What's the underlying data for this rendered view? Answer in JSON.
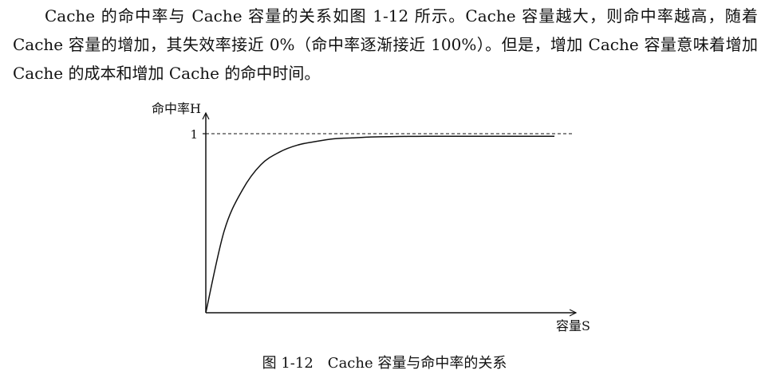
{
  "body_text": "Cache 的命中率与 Cache 容量的关系如图 1-12 所示。Cache 容量越大，则命中率越高，随着 Cache 容量的增加，其失效率接近 0%（命中率逐渐接近 100%）。但是，增加 Cache 容量意味着增加 Cache 的成本和增加 Cache 的命中时间。",
  "figure": {
    "number": "图 1-12",
    "title": "Cache 容量与命中率的关系"
  },
  "chart_data": {
    "type": "line",
    "xlabel": "容量S",
    "ylabel": "命中率H",
    "y_tick_labels": [
      "1"
    ],
    "ylim": [
      0,
      1
    ],
    "xlim": [
      0,
      1
    ],
    "grid": false,
    "reference_line": {
      "y": 1,
      "style": "dashed"
    },
    "series": [
      {
        "x": [
          0,
          0.05,
          0.1,
          0.15,
          0.2,
          0.25,
          0.3,
          0.35,
          0.4,
          0.45,
          0.5,
          0.55,
          0.6,
          0.65,
          0.7,
          0.75,
          0.8,
          0.85,
          0.9,
          0.95
        ],
        "y": [
          0,
          0.47,
          0.7,
          0.84,
          0.91,
          0.95,
          0.97,
          0.985,
          0.99,
          0.995,
          0.997,
          0.998,
          0.999,
          0.999,
          0.999,
          0.999,
          0.999,
          0.999,
          0.999,
          0.999
        ]
      }
    ]
  }
}
